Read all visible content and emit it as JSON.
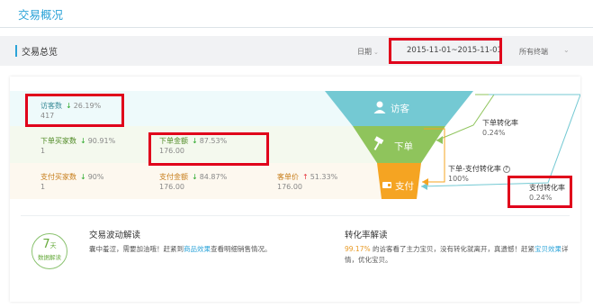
{
  "page": {
    "title": "交易概况"
  },
  "toolbar": {
    "section_title": "交易总览",
    "date_label": "日期",
    "date_range": "2015-11-01~2015-11-01",
    "terminal": "所有终端"
  },
  "metrics": {
    "visitors": {
      "label": "访客数",
      "change": "26.19%",
      "value": "417"
    },
    "order_buyers": {
      "label": "下单买家数",
      "change": "90.91%",
      "value": "1"
    },
    "order_amount": {
      "label": "下单金额",
      "change": "87.53%",
      "value": "176.00"
    },
    "pay_buyers": {
      "label": "支付买家数",
      "change": "90%",
      "value": "1"
    },
    "pay_amount": {
      "label": "支付金额",
      "change": "84.87%",
      "value": "176.00"
    },
    "unit_price": {
      "label": "客单价",
      "change": "51.33%",
      "value": "176.00"
    }
  },
  "funnel": {
    "visit_label": "访客",
    "order_label": "下单",
    "pay_label": "支付"
  },
  "conversion": {
    "order_rate_label": "下单转化率",
    "order_rate": "0.24%",
    "order_to_pay_label": "下单-支付转化率",
    "order_to_pay": "100%",
    "pay_rate_label": "支付转化率",
    "pay_rate": "0.24%"
  },
  "trend_section": {
    "badge_number": "7",
    "badge_unit": "天",
    "badge_sub": "数据解读",
    "title": "交易波动解读",
    "text_before": "囊中羞涩，需要加油哦！赶紧到",
    "link": "商品效果",
    "text_after": "查看明细销售情况。"
  },
  "conversion_section": {
    "title": "转化率解读",
    "highlight": "99.17%",
    "text_before": "的访客看了主力宝贝，没有转化就离开，真遗憾！赶紧",
    "link": "宝贝效果",
    "text_after": "详情，优化宝贝。"
  },
  "colors": {
    "accent": "#2ba3d8",
    "funnel_visit": "#74c9d3",
    "funnel_order": "#8fc45c",
    "funnel_pay": "#f5a422",
    "highlight_box": "#e0001b"
  }
}
